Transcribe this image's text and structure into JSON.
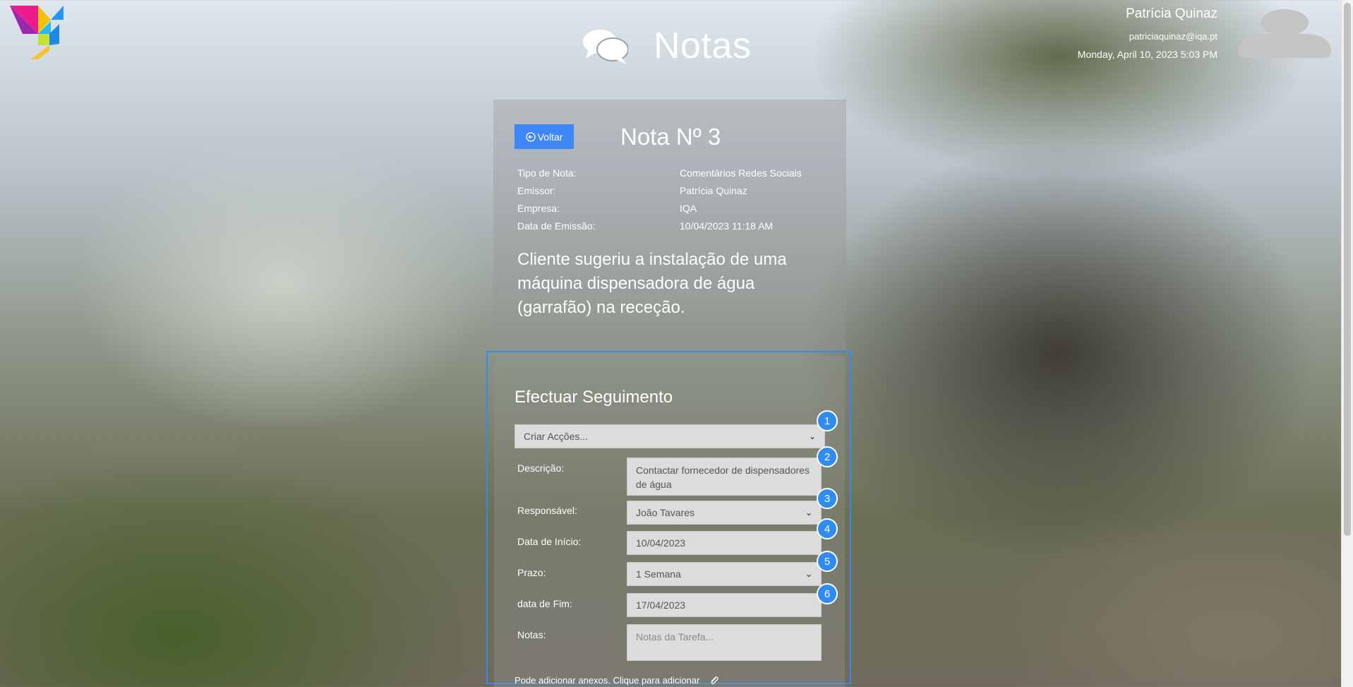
{
  "header": {
    "title": "Notas",
    "user": {
      "name": "Patrícia Quinaz",
      "email": "patriciaquinaz@iqa.pt",
      "datetime": "Monday, April 10, 2023 5:03 PM"
    }
  },
  "note": {
    "back_label": "Voltar",
    "title": "Nota Nº 3",
    "meta": [
      {
        "key": "Tipo de Nota:",
        "value": "Comentários Redes Sociais"
      },
      {
        "key": "Emissor:",
        "value": "Patrícia Quinaz"
      },
      {
        "key": "Empresa:",
        "value": "IQA"
      },
      {
        "key": "Data de Emissão:",
        "value": "10/04/2023 11:18 AM"
      }
    ],
    "body": "Cliente sugeriu a instalação de uma máquina dispensadora de água (garrafão) na receção."
  },
  "followup": {
    "title": "Efectuar Seguimento",
    "action_select": "Criar Acções...",
    "labels": {
      "description": "Descrição:",
      "responsible": "Responsável:",
      "start_date": "Data de Início:",
      "deadline": "Prazo:",
      "end_date": "data de Fim:",
      "notes": "Notas:"
    },
    "values": {
      "description": "Contactar fornecedor de dispensadores de água",
      "responsible": "João Tavares",
      "start_date": "10/04/2023",
      "deadline": "1 Semana",
      "end_date": "17/04/2023"
    },
    "notes_placeholder": "Notas da Tarefa...",
    "attach_text": "Pode adicionar anexos. Clique para adicionar",
    "badges": [
      "1",
      "2",
      "3",
      "4",
      "5",
      "6"
    ]
  },
  "colors": {
    "accent": "#3f86f7",
    "highlight": "#2f8cf0"
  }
}
